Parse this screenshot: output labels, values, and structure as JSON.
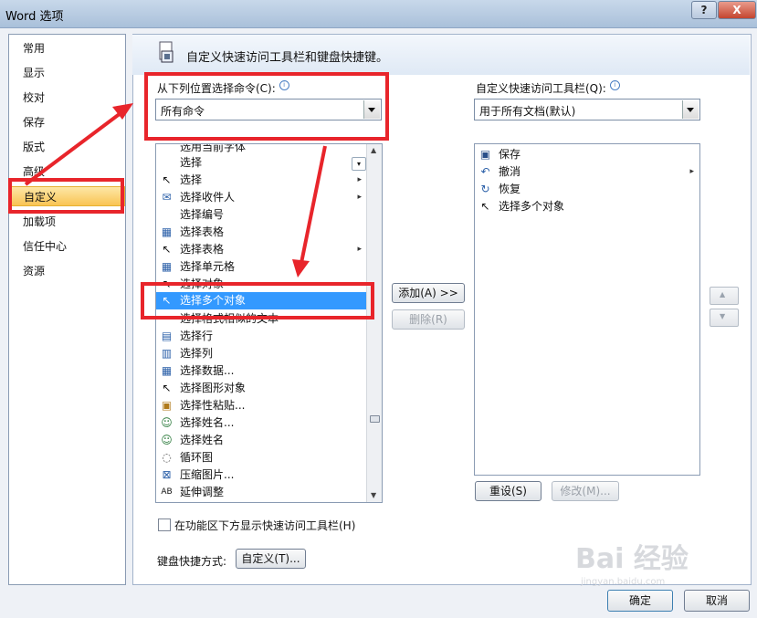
{
  "window": {
    "title": "Word 选项",
    "help": "?",
    "close": "X"
  },
  "sidebar": {
    "items": [
      {
        "label": "常用"
      },
      {
        "label": "显示"
      },
      {
        "label": "校对"
      },
      {
        "label": "保存"
      },
      {
        "label": "版式"
      },
      {
        "label": "高级"
      },
      {
        "label": "自定义"
      },
      {
        "label": "加载项"
      },
      {
        "label": "信任中心"
      },
      {
        "label": "资源"
      }
    ],
    "selected": "自定义"
  },
  "header": {
    "title": "自定义快速访问工具栏和键盘快捷键。"
  },
  "left": {
    "choose_label": "从下列位置选择命令(C):",
    "choose_value": "所有命令",
    "commands": [
      {
        "icon": "",
        "label": "选用当前字体"
      },
      {
        "icon": "",
        "label": "选择"
      },
      {
        "icon": "pointer-icon",
        "label": "选择",
        "sub": "▸"
      },
      {
        "icon": "mail-merge-icon",
        "label": "选择收件人",
        "sub": "▸"
      },
      {
        "icon": "",
        "label": "选择编号"
      },
      {
        "icon": "table-icon",
        "label": "选择表格"
      },
      {
        "icon": "pointer-icon",
        "label": "选择表格",
        "sub": "▸"
      },
      {
        "icon": "table-cell-icon",
        "label": "选择单元格"
      },
      {
        "icon": "pointer-icon",
        "label": "选择对象"
      },
      {
        "icon": "multi-select-icon",
        "label": "选择多个对象"
      },
      {
        "icon": "",
        "label": "选择格式相似的文本"
      },
      {
        "icon": "table-row-icon",
        "label": "选择行"
      },
      {
        "icon": "table-col-icon",
        "label": "选择列"
      },
      {
        "icon": "data-icon",
        "label": "选择数据..."
      },
      {
        "icon": "pointer-icon",
        "label": "选择图形对象"
      },
      {
        "icon": "paste-icon",
        "label": "选择性粘贴..."
      },
      {
        "icon": "contact-icon",
        "label": "选择姓名..."
      },
      {
        "icon": "contact-icon",
        "label": "选择姓名"
      },
      {
        "icon": "cycle-icon",
        "label": "循环图"
      },
      {
        "icon": "compress-icon",
        "label": "压缩图片..."
      },
      {
        "icon": "stretch-icon",
        "label": "延伸调整"
      }
    ],
    "selected": "选择多个对象"
  },
  "buttons": {
    "add": "添加(A) >>",
    "remove": "删除(R)",
    "reset": "重设(S)",
    "modify": "修改(M)...",
    "customize": "自定义(T)...",
    "ok": "确定",
    "cancel": "取消"
  },
  "right": {
    "toolbar_label": "自定义快速访问工具栏(Q):",
    "toolbar_value": "用于所有文档(默认)",
    "items": [
      {
        "icon": "save-icon",
        "label": "保存"
      },
      {
        "icon": "undo-icon",
        "label": "撤消",
        "sub": "▸"
      },
      {
        "icon": "redo-icon",
        "label": "恢复"
      },
      {
        "icon": "multi-select-icon",
        "label": "选择多个对象"
      }
    ]
  },
  "options": {
    "below_ribbon": "在功能区下方显示快速访问工具栏(H)",
    "keyboard_label": "键盘快捷方式:"
  },
  "watermark": {
    "main": "Bai 经验",
    "sub": "jingyan.baidu.com"
  },
  "colors": {
    "highlight": "#e8252b",
    "selection": "#3399ff",
    "sidebar_selection": "#f9c453"
  }
}
